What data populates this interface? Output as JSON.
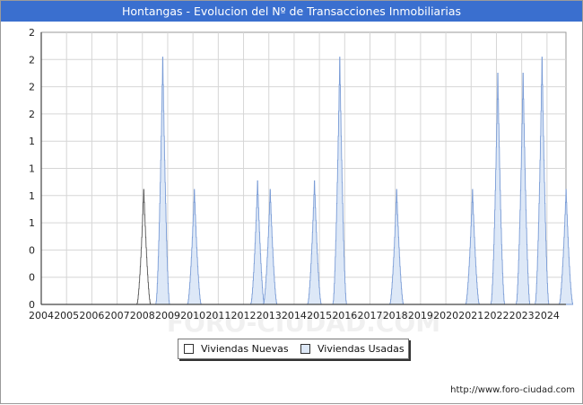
{
  "title": "Hontangas - Evolucion del Nº de Transacciones Inmobiliarias",
  "credit": "http://www.foro-ciudad.com",
  "watermark": "FORO-CIUDAD.COM",
  "chart_data": {
    "type": "area",
    "x_start": 2004,
    "x_end": 2024.75,
    "ylim": [
      0,
      2.2
    ],
    "y_tick_labels": [
      "0",
      "0",
      "0",
      "1",
      "1",
      "1",
      "1",
      "2",
      "2",
      "2",
      "2"
    ],
    "x_tick_labels": [
      "2004",
      "2005",
      "2006",
      "2007",
      "2008",
      "2009",
      "2010",
      "2011",
      "2012",
      "2013",
      "2014",
      "2015",
      "2016",
      "2017",
      "2018",
      "2019",
      "2020",
      "2021",
      "2022",
      "2023",
      "2024"
    ],
    "grid": true,
    "legend_position": "bottom",
    "series": [
      {
        "name": "Viviendas Nuevas",
        "color": "#ffffff",
        "stroke": "#555555",
        "points": [
          [
            2008.05,
            0.93
          ]
        ]
      },
      {
        "name": "Viviendas Usadas",
        "color": "#dde8f7",
        "stroke": "#7a9cd6",
        "points": [
          [
            2008.8,
            2.0
          ],
          [
            2010.05,
            0.93
          ],
          [
            2012.55,
            1.0
          ],
          [
            2013.05,
            0.93
          ],
          [
            2014.8,
            1.0
          ],
          [
            2015.8,
            2.0
          ],
          [
            2018.05,
            0.93
          ],
          [
            2021.05,
            0.93
          ],
          [
            2022.05,
            1.87
          ],
          [
            2023.05,
            1.87
          ],
          [
            2023.8,
            2.0
          ],
          [
            2024.75,
            0.93
          ]
        ]
      }
    ]
  }
}
